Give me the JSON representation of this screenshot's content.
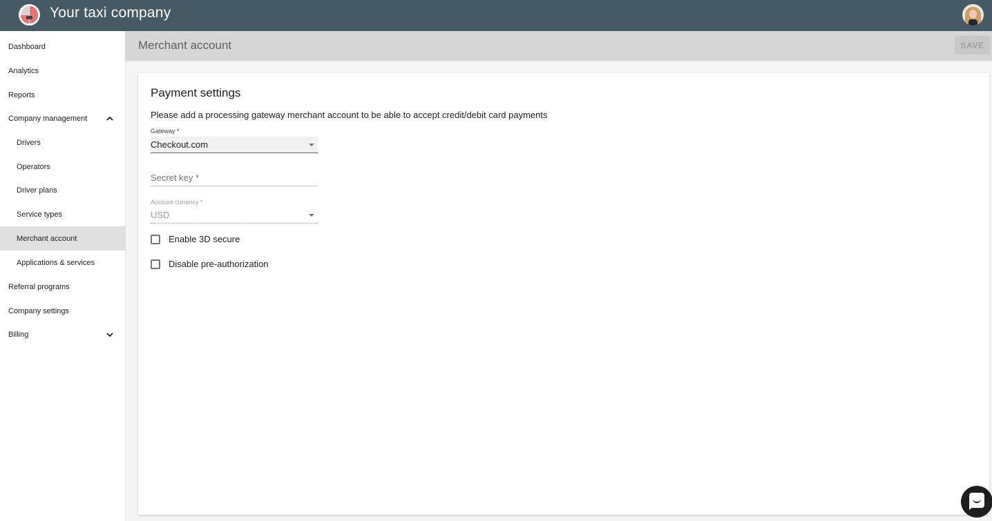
{
  "app": {
    "title": "Your taxi company",
    "logo_icon": "taxi-company-logo",
    "avatar_icon": "user-avatar"
  },
  "sidebar": {
    "items": [
      {
        "label": "Dashboard",
        "level": "top"
      },
      {
        "label": "Analytics",
        "level": "top"
      },
      {
        "label": "Reports",
        "level": "top"
      },
      {
        "label": "Company management",
        "level": "top",
        "expandable": true,
        "expanded": true
      },
      {
        "label": "Drivers",
        "level": "sub"
      },
      {
        "label": "Operators",
        "level": "sub"
      },
      {
        "label": "Driver plans",
        "level": "sub"
      },
      {
        "label": "Service types",
        "level": "sub"
      },
      {
        "label": "Merchant account",
        "level": "sub",
        "active": true
      },
      {
        "label": "Applications & services",
        "level": "sub"
      },
      {
        "label": "Referral programs",
        "level": "top"
      },
      {
        "label": "Company settings",
        "level": "top"
      },
      {
        "label": "Billing",
        "level": "top",
        "expandable": true,
        "expanded": false
      }
    ]
  },
  "header": {
    "title": "Merchant account",
    "save_label": "SAVE"
  },
  "payment": {
    "title": "Payment settings",
    "description": "Please add a processing gateway merchant account to be able to accept credit/debit card payments",
    "gateway": {
      "label": "Gateway *",
      "value": "Checkout.com"
    },
    "secret_key": {
      "placeholder": "Secret key *",
      "value": ""
    },
    "currency": {
      "label": "Account currency *",
      "value": "USD"
    },
    "checkboxes": [
      {
        "label": "Enable 3D secure",
        "checked": false
      },
      {
        "label": "Disable pre-authorization",
        "checked": false
      }
    ]
  },
  "chat": {
    "icon": "chat-bubble-icon"
  },
  "colors": {
    "topbar": "#455a64",
    "subheader": "#d6d6d6",
    "active_nav": "#e0e0e0"
  }
}
